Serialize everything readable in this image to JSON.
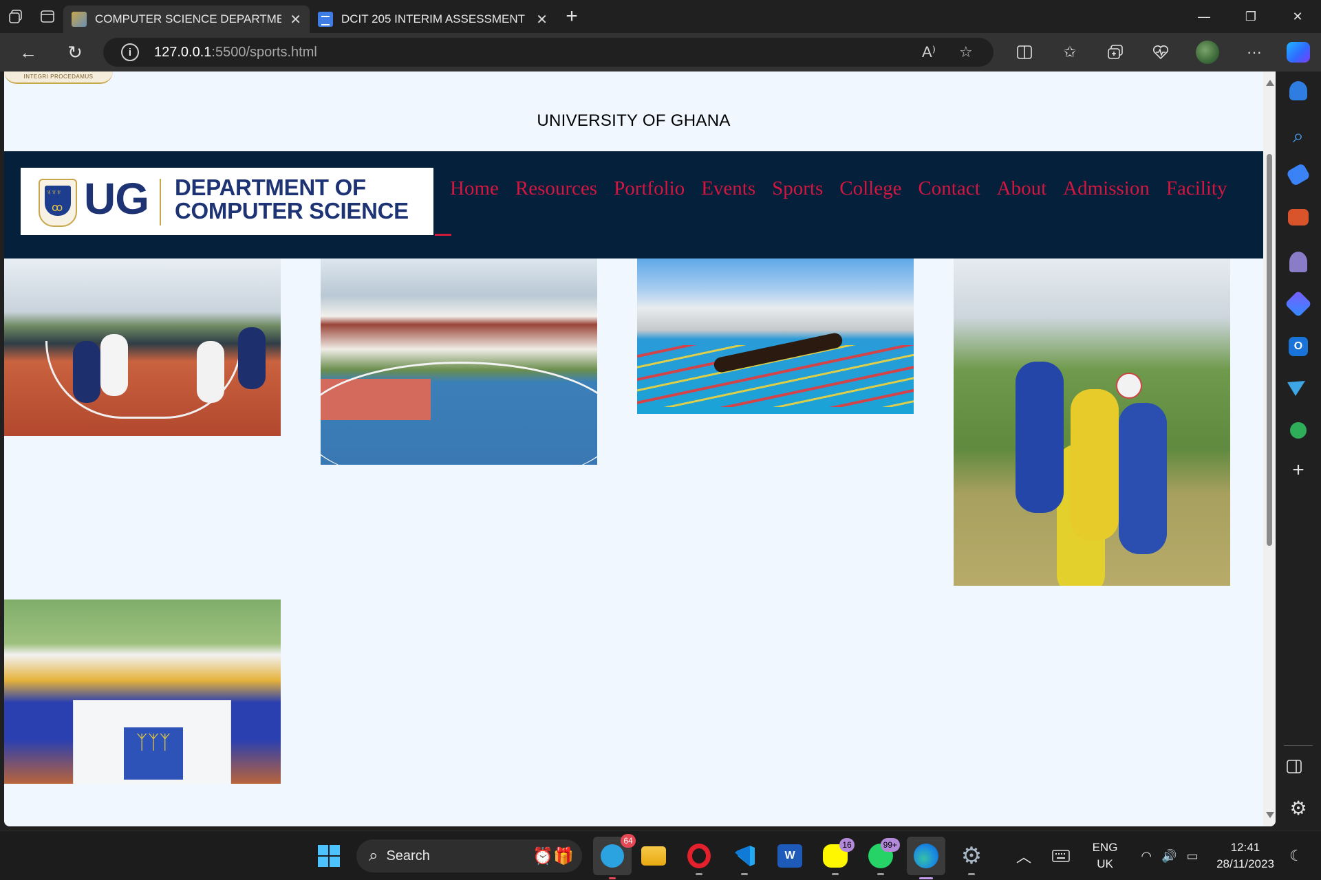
{
  "browser": {
    "tabs": [
      {
        "title": "COMPUTER SCIENCE DEPARTME",
        "active": true
      },
      {
        "title": "DCIT 205 INTERIM ASSESSMENT",
        "active": false
      }
    ],
    "url_host": "127.0.0.1",
    "url_path": ":5500/sports.html",
    "read_aloud_label": "A⁾"
  },
  "page": {
    "logo_motto": "INTEGRI PROCEDAMUS",
    "university_title": "UNIVERSITY OF GHANA",
    "brand": {
      "short": "UG",
      "department_line1": "DEPARTMENT OF",
      "department_line2": "COMPUTER SCIENCE"
    },
    "menu": [
      "Home",
      "Resources",
      "Portfolio",
      "Events",
      "Sports",
      "College",
      "Contact",
      "About",
      "Admission",
      "Facility"
    ],
    "colors": {
      "nav_bg": "#04203b",
      "menu_link": "#d41640",
      "page_bg": "#f0f7ff",
      "brand_navy": "#1d3374"
    },
    "photos": [
      "basketball-game",
      "basketball-court",
      "swimming-race",
      "football-match",
      "athletics-team"
    ]
  },
  "taskbar": {
    "search_placeholder": "Search",
    "telegram_badge": "64",
    "snapchat_badge": "16",
    "whatsapp_badge": "99+",
    "lang_line1": "ENG",
    "lang_line2": "UK",
    "time": "12:41",
    "date": "28/11/2023"
  }
}
